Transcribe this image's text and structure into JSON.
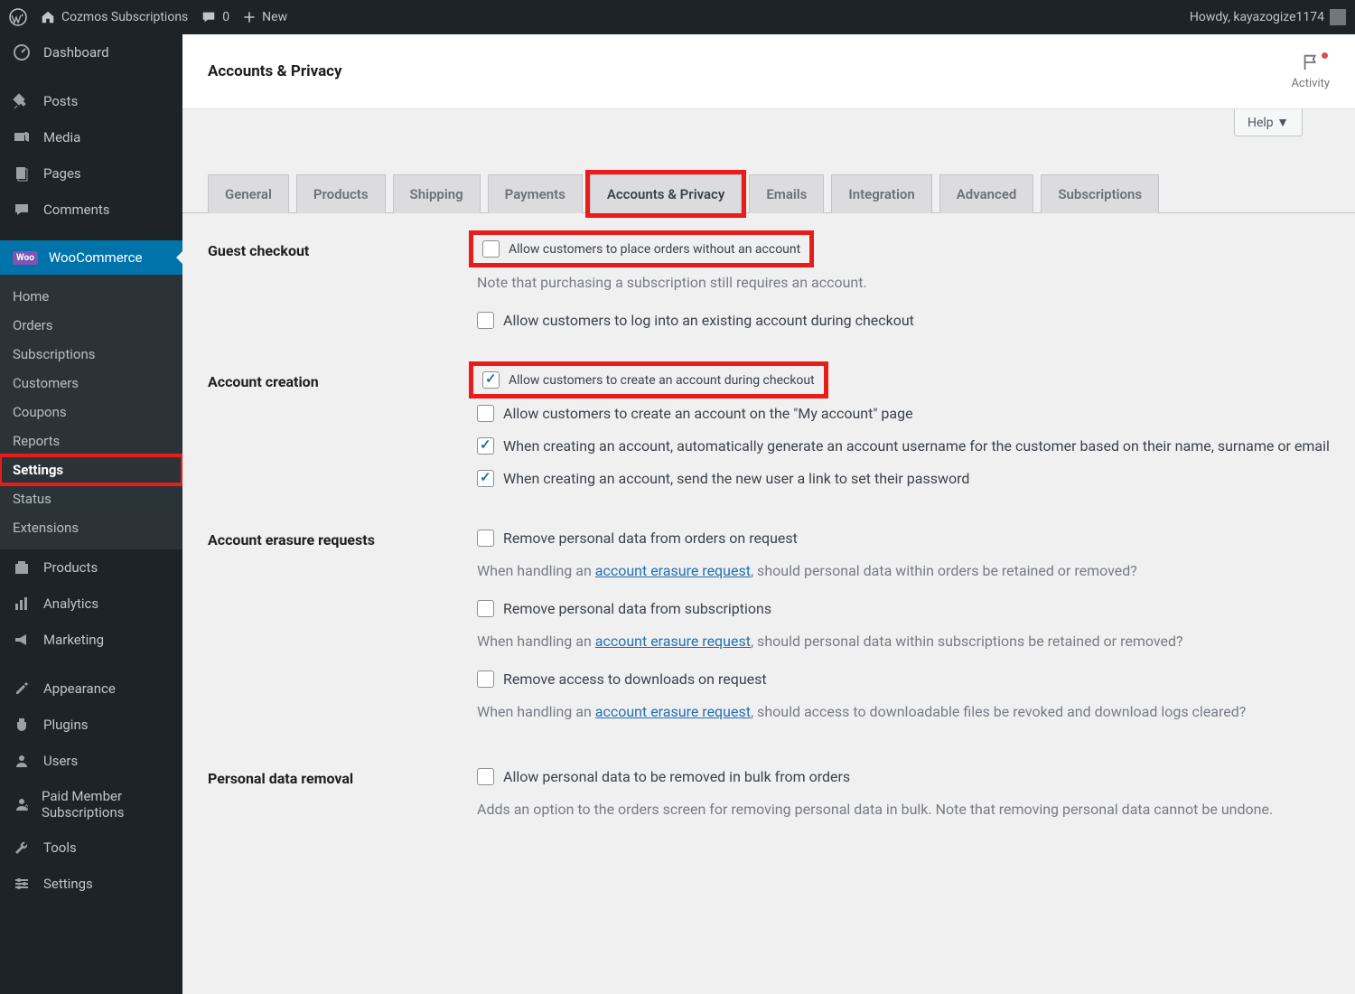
{
  "adminBar": {
    "siteTitle": "Cozmos Subscriptions",
    "commentsCount": "0",
    "newLabel": "New",
    "howdy": "Howdy, kayazogize1174"
  },
  "sidebar": {
    "dashboard": "Dashboard",
    "posts": "Posts",
    "media": "Media",
    "pages": "Pages",
    "comments": "Comments",
    "woocommerce": "WooCommerce",
    "wooSub": {
      "home": "Home",
      "orders": "Orders",
      "subscriptions": "Subscriptions",
      "customers": "Customers",
      "coupons": "Coupons",
      "reports": "Reports",
      "settings": "Settings",
      "status": "Status",
      "extensions": "Extensions"
    },
    "products": "Products",
    "analytics": "Analytics",
    "marketing": "Marketing",
    "appearance": "Appearance",
    "plugins": "Plugins",
    "users": "Users",
    "paidMember": "Paid Member Subscriptions",
    "tools": "Tools",
    "settings2": "Settings"
  },
  "header": {
    "pageTitle": "Accounts & Privacy",
    "activity": "Activity",
    "help": "Help"
  },
  "tabs": {
    "general": "General",
    "products": "Products",
    "shipping": "Shipping",
    "payments": "Payments",
    "accountsPrivacy": "Accounts & Privacy",
    "emails": "Emails",
    "integration": "Integration",
    "advanced": "Advanced",
    "subscriptions": "Subscriptions"
  },
  "sections": {
    "guestCheckout": {
      "title": "Guest checkout",
      "opt1": "Allow customers to place orders without an account",
      "note1": "Note that purchasing a subscription still requires an account.",
      "opt2": "Allow customers to log into an existing account during checkout"
    },
    "accountCreation": {
      "title": "Account creation",
      "opt1": "Allow customers to create an account during checkout",
      "opt2": "Allow customers to create an account on the \"My account\" page",
      "opt3": "When creating an account, automatically generate an account username for the customer based on their name, surname or email",
      "opt4": "When creating an account, send the new user a link to set their password"
    },
    "erasure": {
      "title": "Account erasure requests",
      "opt1": "Remove personal data from orders on request",
      "note1a": "When handling an ",
      "linkText": "account erasure request",
      "note1b": ", should personal data within orders be retained or removed?",
      "opt2": "Remove personal data from subscriptions",
      "note2b": ", should personal data within subscriptions be retained or removed?",
      "opt3": "Remove access to downloads on request",
      "note3b": ", should access to downloadable files be revoked and download logs cleared?"
    },
    "personalDataRemoval": {
      "title": "Personal data removal",
      "opt1": "Allow personal data to be removed in bulk from orders",
      "note1": "Adds an option to the orders screen for removing personal data in bulk. Note that removing personal data cannot be undone."
    }
  }
}
